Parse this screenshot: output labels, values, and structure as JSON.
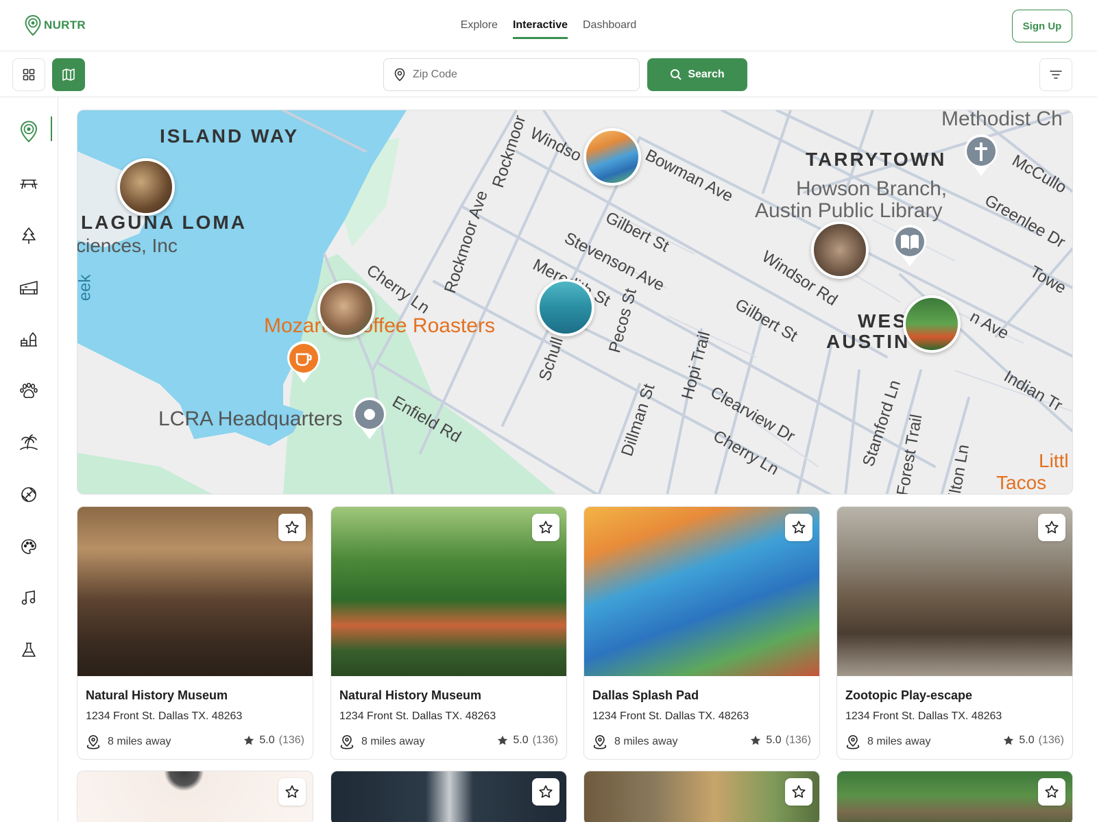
{
  "app": {
    "brand": "NURTR",
    "accent": "#3f8e51"
  },
  "nav": {
    "items": [
      {
        "label": "Explore"
      },
      {
        "label": "Interactive"
      },
      {
        "label": "Dashboard"
      }
    ],
    "active": "Interactive"
  },
  "header": {
    "signup_label": "Sign Up"
  },
  "toolbar": {
    "view_grid_icon": "grid-icon",
    "view_map_icon": "map-icon",
    "zip_placeholder": "Zip Code",
    "search_label": "Search",
    "filter_icon": "filter-lines-icon"
  },
  "sidebar": {
    "items": [
      {
        "icon": "location-pin-icon",
        "active": true
      },
      {
        "icon": "picnic-table-icon"
      },
      {
        "icon": "tree-icon"
      },
      {
        "icon": "building-icon"
      },
      {
        "icon": "playground-icon"
      },
      {
        "icon": "paw-icon"
      },
      {
        "icon": "palm-island-icon"
      },
      {
        "icon": "football-icon"
      },
      {
        "icon": "palette-icon"
      },
      {
        "icon": "music-note-icon"
      },
      {
        "icon": "flask-icon"
      }
    ]
  },
  "map": {
    "labels": {
      "island_way": "ISLAND WAY",
      "laguna_loma": "LAGUNA LOMA",
      "sciences": "ciences, Inc",
      "creek": "eek",
      "mozart": "Mozart's Coffee Roasters",
      "lcra": "LCRA Headquarters",
      "cherry1": "Cherry Ln",
      "rockmoor_ave": "Rockmoor Ave",
      "rockmoor": "Rockmoor",
      "windsor_top": "Windso",
      "bowman": "Bowman Ave",
      "gilbert1": "Gilbert St",
      "stevenson": "Stevenson Ave",
      "meredith": "Meredith St",
      "pecos": "Pecos St",
      "schulle": "Schull",
      "enfield": "Enfield Rd",
      "dillman": "Dillman St",
      "hopi": "Hopi Trail",
      "clearview": "Clearview Dr",
      "cherry2": "Cherry Ln",
      "windsor_rd": "Windsor Rd",
      "gilbert2": "Gilbert St",
      "tarrytown": "TARRYTOWN",
      "howson1": "Howson Branch,",
      "howson2": "Austin Public Library",
      "methodist": "Methodist Ch",
      "mccullough": "McCullo",
      "greenlee": "Greenlee Dr",
      "towe": "Towe",
      "west": "WEST",
      "austin": "AUSTIN H",
      "n_ave": "n Ave",
      "indian": "Indian Tr",
      "stamford": "Stamford Ln",
      "forest": "Forest Trail",
      "ilton": "ilton Ln",
      "little": "Littl",
      "tacos": "Tacos"
    }
  },
  "cards": [
    {
      "title": "Natural History Museum",
      "address": "1234 Front St. Dallas TX. 48263",
      "distance": "8 miles away",
      "rating": "5.0",
      "count": "(136)"
    },
    {
      "title": "Natural History Museum",
      "address": "1234 Front St. Dallas TX. 48263",
      "distance": "8 miles away",
      "rating": "5.0",
      "count": "(136)"
    },
    {
      "title": "Dallas Splash Pad",
      "address": "1234 Front St. Dallas TX. 48263",
      "distance": "8 miles away",
      "rating": "5.0",
      "count": "(136)"
    },
    {
      "title": "Zootopic Play-escape",
      "address": "1234 Front St. Dallas TX. 48263",
      "distance": "8 miles away",
      "rating": "5.0",
      "count": "(136)"
    }
  ]
}
